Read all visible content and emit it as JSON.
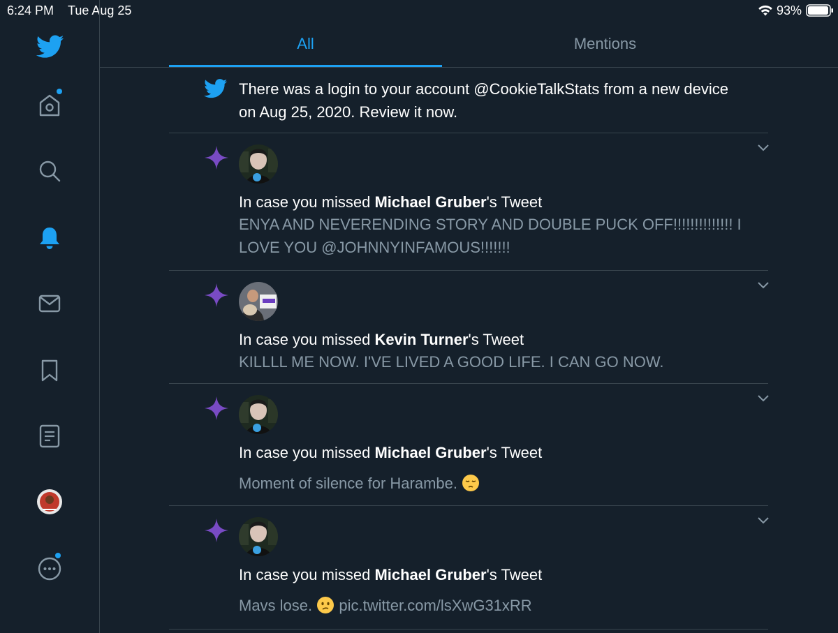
{
  "status": {
    "time": "6:24 PM",
    "date": "Tue Aug 25",
    "battery": "93%"
  },
  "sidebar": {
    "items": [
      {
        "icon": "twitter-bird-icon"
      },
      {
        "icon": "home-icon",
        "has_dot": true
      },
      {
        "icon": "search-icon"
      },
      {
        "icon": "bell-icon",
        "active": true
      },
      {
        "icon": "mail-icon"
      },
      {
        "icon": "bookmark-icon"
      },
      {
        "icon": "lists-icon"
      },
      {
        "icon": "profile-avatar"
      },
      {
        "icon": "more-icon",
        "has_dot": true
      }
    ]
  },
  "tabs": {
    "all": "All",
    "mentions": "Mentions"
  },
  "notifications": {
    "login": {
      "text": "There was a login to your account @CookieTalkStats from a new device on Aug 25, 2020. Review it now."
    },
    "items": [
      {
        "prefix": "In case you missed ",
        "name": "Michael Gruber",
        "suffix": "'s Tweet",
        "text": "ENYA AND NEVERENDING STORY AND DOUBLE PUCK OFF!!!!!!!!!!!!!! I LOVE YOU @JOHNNYINFAMOUS!!!!!!!"
      },
      {
        "prefix": "In case you missed ",
        "name": "Kevin Turner",
        "suffix": "'s Tweet",
        "text": "KILLLL ME NOW. I'VE LIVED A GOOD LIFE. I CAN GO NOW."
      },
      {
        "prefix": "In case you missed ",
        "name": "Michael Gruber",
        "suffix": "'s Tweet",
        "text": "Moment of silence for Harambe.",
        "emoji": "pensive-face"
      },
      {
        "prefix": "In case you missed ",
        "name": "Michael Gruber",
        "suffix": "'s Tweet",
        "text_before": "Mavs lose.",
        "emoji": "confused-face",
        "text_after": "pic.twitter.com/lsXwG31xRR"
      }
    ]
  },
  "colors": {
    "background": "#15202b",
    "accent": "#1da1f2",
    "muted": "#8899a6",
    "divider": "#38444d",
    "sparkle": "#794bc4"
  }
}
